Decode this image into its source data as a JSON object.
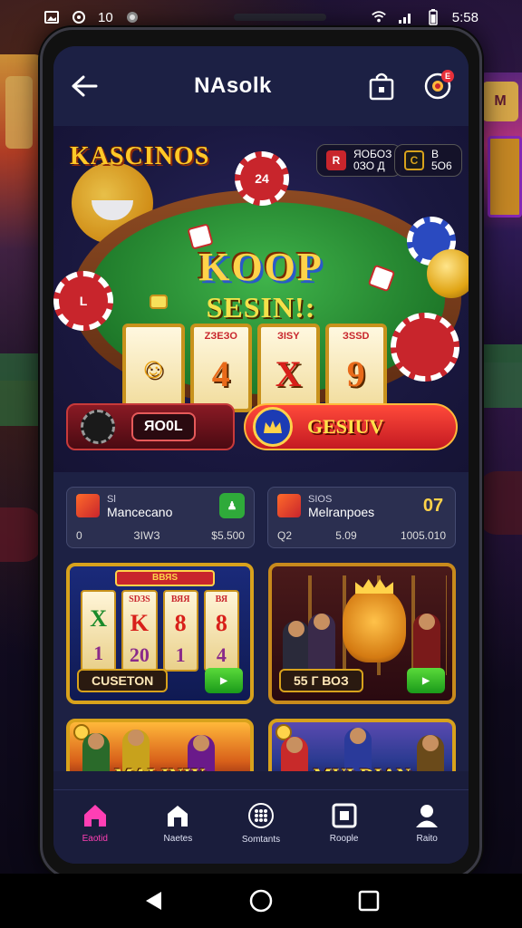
{
  "status_bar": {
    "time_left": "10",
    "time_right": "5:58"
  },
  "app": {
    "title": "NAsolk",
    "notification_badge": "E"
  },
  "hero": {
    "brand": "KASCINOS",
    "headline": "KOOP",
    "subheadline": "SESIN!:",
    "chip_label_top": "24",
    "chip_label_left": "L",
    "balance_a": {
      "icon": "R",
      "line1": "ЯОБОЗ",
      "line2": "0ЗО Д"
    },
    "balance_b": {
      "icon": "C",
      "line1": "В",
      "line2": "5О6"
    },
    "reels": [
      {
        "top": "",
        "main": "☺"
      },
      {
        "top": "ZЗЕЗО",
        "main": "4"
      },
      {
        "top": "ЗISY",
        "main": "X"
      },
      {
        "top": "ЗSSD",
        "main": "9"
      }
    ],
    "jackpot_amount": "ЯО0L",
    "cta_label": "GESIUV"
  },
  "stats": [
    {
      "small": "Sl",
      "name": "Mancecano",
      "bottom_left": "0",
      "bottom_mid": "ЗIWЗ",
      "bottom_right": "$5.500",
      "badge": "♟"
    },
    {
      "small": "SIOS",
      "name": "Melranpoes",
      "bottom_left": "Q2",
      "bottom_mid": "5.09",
      "bottom_right": "1005.010",
      "badge": "07"
    }
  ],
  "games": [
    {
      "banner": "ВВЯS",
      "label": "CUSETON",
      "play": "▶",
      "reels": [
        {
          "top": "",
          "sym": "X",
          "low": "1"
        },
        {
          "top": "SDЗS",
          "sym": "K",
          "low": "20"
        },
        {
          "top": "ВЯЯ",
          "sym": "8",
          "low": "1"
        },
        {
          "top": "ВЯ",
          "sym": "8",
          "low": "4"
        }
      ]
    },
    {
      "banner": "",
      "label": "55 Г ВОЗ",
      "play": "▶"
    }
  ],
  "promos": [
    {
      "title": "MALINIY"
    },
    {
      "title": "MULDIAN"
    }
  ],
  "tabs": [
    {
      "label": "Eaotid",
      "icon": "home-icon",
      "active": true
    },
    {
      "label": "Naetes",
      "icon": "store-icon",
      "active": false
    },
    {
      "label": "Somtants",
      "icon": "grid-dots-icon",
      "active": false
    },
    {
      "label": "Roople",
      "icon": "square-target-icon",
      "active": false
    },
    {
      "label": "Raito",
      "icon": "profile-icon",
      "active": false
    }
  ],
  "colors": {
    "accent_pink": "#ff3fb4",
    "gold": "#d8a21c",
    "app_background": "#1a1d3c",
    "cta_red": "#d41f27"
  }
}
